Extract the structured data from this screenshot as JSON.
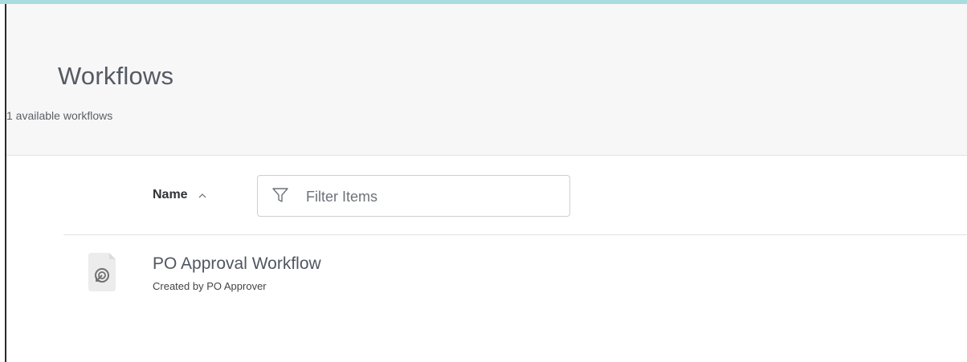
{
  "header": {
    "title": "Workflows",
    "subtitle": "1 available workflows"
  },
  "toolbar": {
    "sort_label": "Name",
    "sort_direction": "ascending",
    "sort_icon": "chevron-up-icon",
    "filter_placeholder": "Filter Items",
    "filter_value": "",
    "filter_icon": "filter-funnel-icon"
  },
  "workflows": [
    {
      "name": "PO Approval Workflow",
      "created_by": "Created by PO Approver",
      "icon": "workflow-file-icon"
    }
  ],
  "colors": {
    "top_strip": "#a9dcde",
    "header_bg": "#f7f7f7",
    "title": "#555a63",
    "border": "#cfcfcf"
  }
}
